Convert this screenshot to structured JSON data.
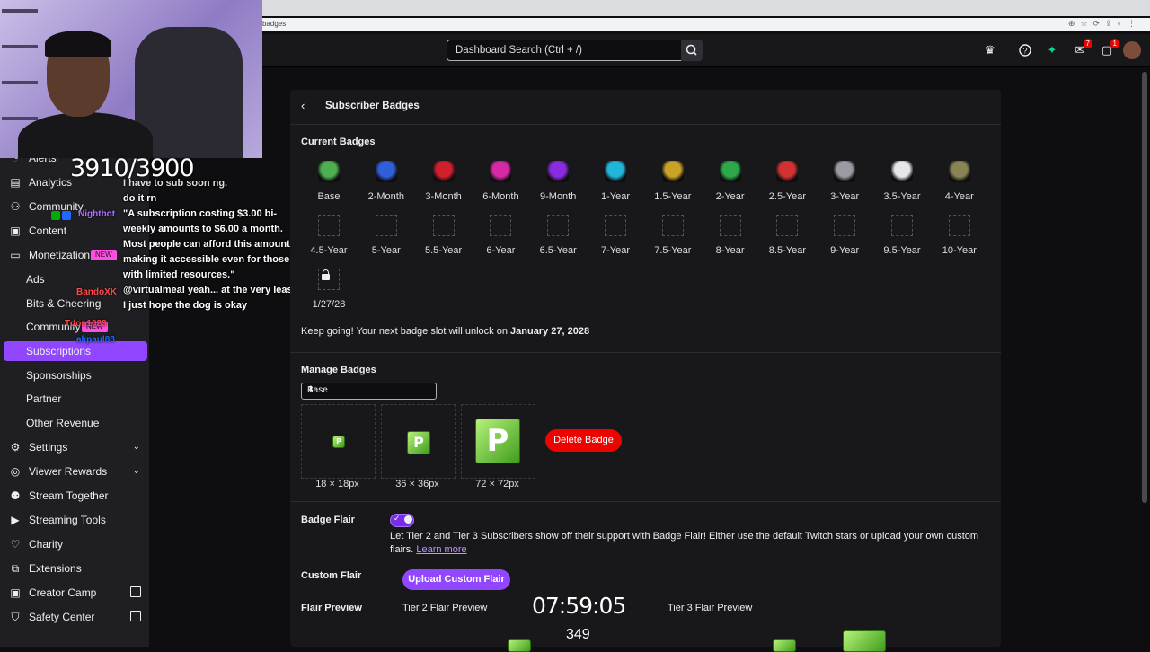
{
  "browser": {
    "url_fragment": "badges"
  },
  "header": {
    "search_placeholder": "Dashboard Search (Ctrl + /)",
    "notifications_inbox": "7",
    "notifications_whispers": "1"
  },
  "overlay": {
    "sub_goal": "3910/3900",
    "timer": "07:59:05",
    "viewers": "349",
    "chat_lines": [
      "I have to sub soon ng.",
      "do it rn",
      "\"A subscription costing $3.00 bi-weekly amounts to $6.00 a month. Most people can afford this amount, making it accessible even for those with limited resources.\"",
      "@virtualmeal yeah... at the very least I just hope the dog is okay"
    ],
    "chat_names": [
      "Nightbot",
      "BandoXK",
      "Tdon1023",
      "akpaul88"
    ]
  },
  "sidebar": {
    "items": [
      {
        "label": "Alerts",
        "icon": "bell-icon"
      },
      {
        "label": "Analytics",
        "icon": "chart-icon"
      },
      {
        "label": "Community",
        "icon": "people-icon"
      },
      {
        "label": "Content",
        "icon": "content-icon"
      },
      {
        "label": "Monetization",
        "icon": "money-icon",
        "tag": "NEW"
      },
      {
        "label": "Ads"
      },
      {
        "label": "Bits & Cheering"
      },
      {
        "label": "Community",
        "tag": "NEW"
      },
      {
        "label": "Subscriptions"
      },
      {
        "label": "Sponsorships"
      },
      {
        "label": "Partner"
      },
      {
        "label": "Other Revenue"
      },
      {
        "label": "Settings",
        "icon": "gear-icon"
      },
      {
        "label": "Viewer Rewards",
        "icon": "reward-icon"
      },
      {
        "label": "Stream Together",
        "icon": "stream-together-icon"
      },
      {
        "label": "Streaming Tools",
        "icon": "camera-icon"
      },
      {
        "label": "Charity",
        "icon": "charity-icon"
      },
      {
        "label": "Extensions",
        "icon": "extensions-icon"
      },
      {
        "label": "Creator Camp",
        "icon": "camp-icon"
      },
      {
        "label": "Safety Center",
        "icon": "shield-icon"
      }
    ]
  },
  "page": {
    "title": "Subscriber Badges",
    "current_badges_title": "Current Badges",
    "badges": [
      {
        "label": "Base",
        "color": "#4caf50"
      },
      {
        "label": "2-Month",
        "color": "#2f5fd9"
      },
      {
        "label": "3-Month",
        "color": "#d0202e"
      },
      {
        "label": "6-Month",
        "color": "#d62aa5"
      },
      {
        "label": "9-Month",
        "color": "#8a2be2"
      },
      {
        "label": "1-Year",
        "color": "#21b6d9"
      },
      {
        "label": "1.5-Year",
        "color": "#c9a227"
      },
      {
        "label": "2-Year",
        "color": "#2fa84a"
      },
      {
        "label": "2.5-Year",
        "color": "#d23232"
      },
      {
        "label": "3-Year",
        "color": "#9a9aa3"
      },
      {
        "label": "3.5-Year",
        "color": "#e6e6ea"
      },
      {
        "label": "4-Year",
        "color": "#8a8355"
      }
    ],
    "empty_slots": [
      "4.5-Year",
      "5-Year",
      "5.5-Year",
      "6-Year",
      "6.5-Year",
      "7-Year",
      "7.5-Year",
      "8-Year",
      "8.5-Year",
      "9-Year",
      "9.5-Year",
      "10-Year"
    ],
    "locked_slot": "1/27/28",
    "unlock_message": "Keep going! Your next badge slot will unlock on",
    "unlock_date": "January 27, 2028",
    "manage_title": "Manage Badges",
    "selected_badge": "Base",
    "sizes": [
      "18 × 18px",
      "36 × 36px",
      "72 × 72px"
    ],
    "delete_label": "Delete Badge",
    "flair_title": "Badge Flair",
    "flair_enabled": true,
    "flair_description": "Let Tier 2 and Tier 3 Subscribers show off their support with Badge Flair! Either use the default Twitch stars or upload your own custom flairs.",
    "learn_more": "Learn more",
    "custom_flair_title": "Custom Flair",
    "upload_label": "Upload Custom Flair",
    "flair_preview_title": "Flair Preview",
    "tier2_preview": "Tier 2 Flair Preview",
    "tier3_preview": "Tier 3 Flair Preview",
    "badge_letter": "P"
  }
}
